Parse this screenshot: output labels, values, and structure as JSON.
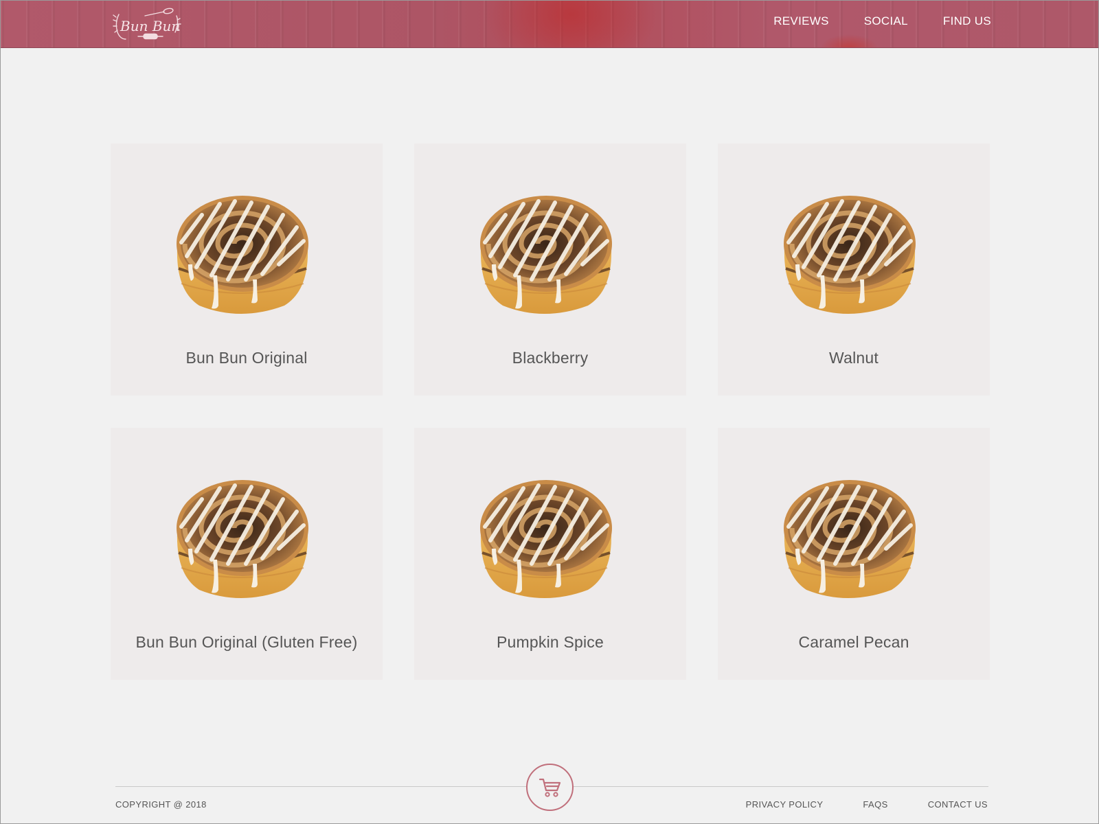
{
  "header": {
    "logo_text": "Bun Bun",
    "nav": [
      "REVIEWS",
      "SOCIAL",
      "FIND US"
    ]
  },
  "products": [
    {
      "name": "Bun Bun Original",
      "image": "cinnamon-roll-image"
    },
    {
      "name": "Blackberry",
      "image": "cinnamon-roll-image"
    },
    {
      "name": "Walnut",
      "image": "cinnamon-roll-image"
    },
    {
      "name": "Bun Bun Original (Gluten Free)",
      "image": "cinnamon-roll-image"
    },
    {
      "name": "Pumpkin Spice",
      "image": "cinnamon-roll-image"
    },
    {
      "name": "Caramel Pecan",
      "image": "cinnamon-roll-image"
    }
  ],
  "footer": {
    "copyright": "COPYRIGHT @ 2018",
    "cart_icon": "shopping-cart-icon",
    "links": [
      "PRIVACY POLICY",
      "FAQS",
      "CONTACT US"
    ]
  },
  "colors": {
    "header_bg": "#b0586a",
    "accent": "#c06f7b",
    "page_bg": "#f1f1f1",
    "card_bg": "#eeebeb",
    "text": "#555555"
  }
}
